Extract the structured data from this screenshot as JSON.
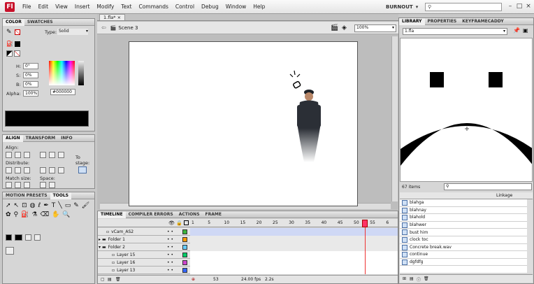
{
  "menubar": {
    "logo": "Fl",
    "items": [
      "File",
      "Edit",
      "View",
      "Insert",
      "Modify",
      "Text",
      "Commands",
      "Control",
      "Debug",
      "Window",
      "Help"
    ],
    "workspace": "BURNOUT",
    "search_placeholder": "",
    "window_buttons": [
      "–",
      "□",
      "×"
    ]
  },
  "document": {
    "tab": "1.fla*",
    "scene": "Scene 3",
    "zoom": "100%"
  },
  "color_panel": {
    "tabs": [
      "COLOR",
      "SWATCHES"
    ],
    "type_label": "Type:",
    "type_value": "Solid",
    "h_label": "H:",
    "h_value": "0°",
    "s_label": "S:",
    "s_value": "0%",
    "b_label": "B:",
    "b_value": "0%",
    "alpha_label": "Alpha:",
    "alpha_value": "100%",
    "hex_value": "#000000",
    "swatch_color": "#000000"
  },
  "align_panel": {
    "tabs": [
      "ALIGN",
      "TRANSFORM",
      "INFO"
    ],
    "align_label": "Align:",
    "distribute_label": "Distribute:",
    "match_size_label": "Match size:",
    "space_label": "Space:",
    "to_stage_label": "To stage:"
  },
  "tools_panel": {
    "tabs": [
      "MOTION PRESETS",
      "TOOLS"
    ]
  },
  "timeline": {
    "tabs": [
      "TIMELINE",
      "COMPILER ERRORS",
      "ACTIONS",
      "FRAME"
    ],
    "frame_numbers": [
      "1",
      "5",
      "10",
      "15",
      "20",
      "25",
      "30",
      "35",
      "40",
      "45",
      "50",
      "55",
      "6"
    ],
    "layers": [
      {
        "name": "vCam_AS2",
        "type": "layer"
      },
      {
        "name": "Folder 1",
        "type": "folder"
      },
      {
        "name": "Folder 2",
        "type": "folder"
      },
      {
        "name": "Layer 15",
        "type": "layer"
      },
      {
        "name": "Layer 16",
        "type": "layer"
      },
      {
        "name": "Layer 13",
        "type": "layer"
      }
    ],
    "layer_colors": [
      "#3cb43c",
      "#ff9900",
      "#66ccff",
      "#00cc66",
      "#cc44cc",
      "#3366ff"
    ],
    "fps": "24.00 fps",
    "time": "2.2s",
    "current_frame": "53"
  },
  "library": {
    "tabs": [
      "LIBRARY",
      "PROPERTIES",
      "KEYFRAMECADDY"
    ],
    "doc_select": "1.fla",
    "item_count": "67 items",
    "column_header": "Linkage",
    "items": [
      "blahga",
      "blahnay",
      "blahold",
      "blahwer",
      "bust him",
      "clock toc",
      "Concrete break.wav",
      "continue",
      "dgfdfg"
    ]
  }
}
